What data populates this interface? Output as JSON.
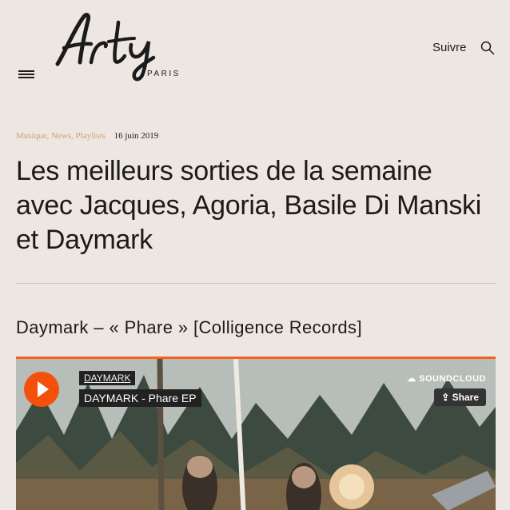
{
  "header": {
    "logo_text": "Arty",
    "logo_subtitle": "PARIS",
    "follow_label": "Suivre"
  },
  "article": {
    "categories": "Musique, News, Playlists",
    "date": "16 juin 2019",
    "title": "Les meilleurs sorties de la semaine avec Jacques, Agoria, Basile Di Manski et Daymark",
    "subtitle": "Daymark – « Phare » [Colligence Records]"
  },
  "player": {
    "artist": "DAYMARK",
    "track": "DAYMARK - Phare EP",
    "brand": "SOUNDCLOUD",
    "share_label": "Share",
    "accent_color": "#f26322"
  }
}
